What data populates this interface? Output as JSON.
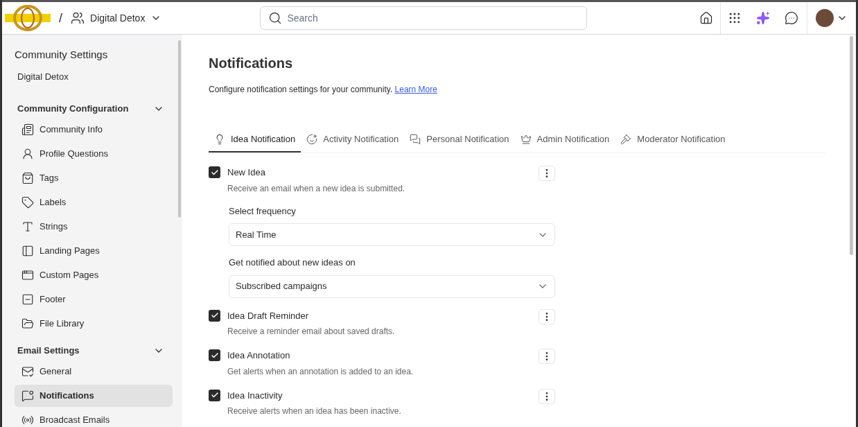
{
  "header": {
    "community": "Digital Detox",
    "separator": "/",
    "search": {
      "placeholder": "Search"
    }
  },
  "sidebar": {
    "title": "Community Settings",
    "subtitle": "Digital Detox",
    "sections": [
      {
        "title": "Community Configuration",
        "expanded": true,
        "items": [
          {
            "label": "Community Info",
            "selected": false
          },
          {
            "label": "Profile Questions",
            "selected": false
          },
          {
            "label": "Tags",
            "selected": false
          },
          {
            "label": "Labels",
            "selected": false
          },
          {
            "label": "Strings",
            "selected": false
          },
          {
            "label": "Landing Pages",
            "selected": false
          },
          {
            "label": "Custom Pages",
            "selected": false
          },
          {
            "label": "Footer",
            "selected": false
          },
          {
            "label": "File Library",
            "selected": false
          }
        ]
      },
      {
        "title": "Email Settings",
        "expanded": true,
        "items": [
          {
            "label": "General",
            "selected": false
          },
          {
            "label": "Notifications",
            "selected": true
          },
          {
            "label": "Broadcast Emails",
            "selected": false
          }
        ]
      }
    ]
  },
  "page": {
    "title": "Notifications",
    "description": "Configure notification settings for your community.",
    "link": "Learn More",
    "tabs": [
      {
        "label": "Idea Notification",
        "selected": true
      },
      {
        "label": "Activity Notification",
        "selected": false
      },
      {
        "label": "Personal Notification",
        "selected": false
      },
      {
        "label": "Admin Notification",
        "selected": false
      },
      {
        "label": "Moderator Notification",
        "selected": false
      }
    ],
    "settings": [
      {
        "title": "New Idea",
        "description": "Receive an email when a new idea is submitted.",
        "checked": true,
        "fields": [
          {
            "label": "Select frequency",
            "value": "Real Time"
          },
          {
            "label": "Get notified about new ideas on",
            "value": "Subscribed campaigns"
          }
        ]
      },
      {
        "title": "Idea Draft Reminder",
        "description": "Receive a reminder email about saved drafts.",
        "checked": true
      },
      {
        "title": "Idea Annotation",
        "description": "Get alerts when an annotation is added to an idea.",
        "checked": true
      },
      {
        "title": "Idea Inactivity",
        "description": "Receive alerts when an idea has been inactive.",
        "checked": true
      }
    ]
  }
}
